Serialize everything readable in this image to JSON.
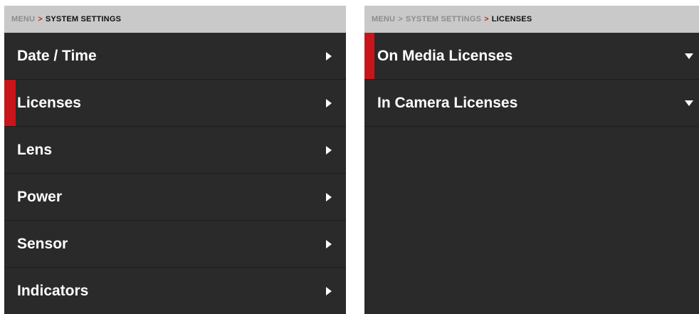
{
  "left_panel": {
    "breadcrumb": {
      "menu": "MENU",
      "separator": ">",
      "current": "SYSTEM SETTINGS"
    },
    "items": [
      {
        "label": "Date / Time",
        "icon": "chevron-right-icon"
      },
      {
        "label": "Licenses",
        "icon": "chevron-right-icon",
        "selected": true
      },
      {
        "label": "Lens",
        "icon": "chevron-right-icon"
      },
      {
        "label": "Power",
        "icon": "chevron-right-icon"
      },
      {
        "label": "Sensor",
        "icon": "chevron-right-icon"
      },
      {
        "label": "Indicators",
        "icon": "chevron-right-icon"
      }
    ]
  },
  "right_panel": {
    "breadcrumb": {
      "menu": "MENU",
      "separator_1": ">",
      "parent": "SYSTEM SETTINGS",
      "separator_2": ">",
      "current": "LICENSES"
    },
    "items": [
      {
        "label": "On Media Licenses",
        "icon": "chevron-down-icon",
        "selected": true
      },
      {
        "label": "In Camera Licenses",
        "icon": "chevron-down-icon"
      }
    ]
  },
  "colors": {
    "panel_background": "#2a2a2a",
    "breadcrumb_background": "#c9c9c9",
    "selection_accent": "#c8151b",
    "text": "#ffffff"
  }
}
